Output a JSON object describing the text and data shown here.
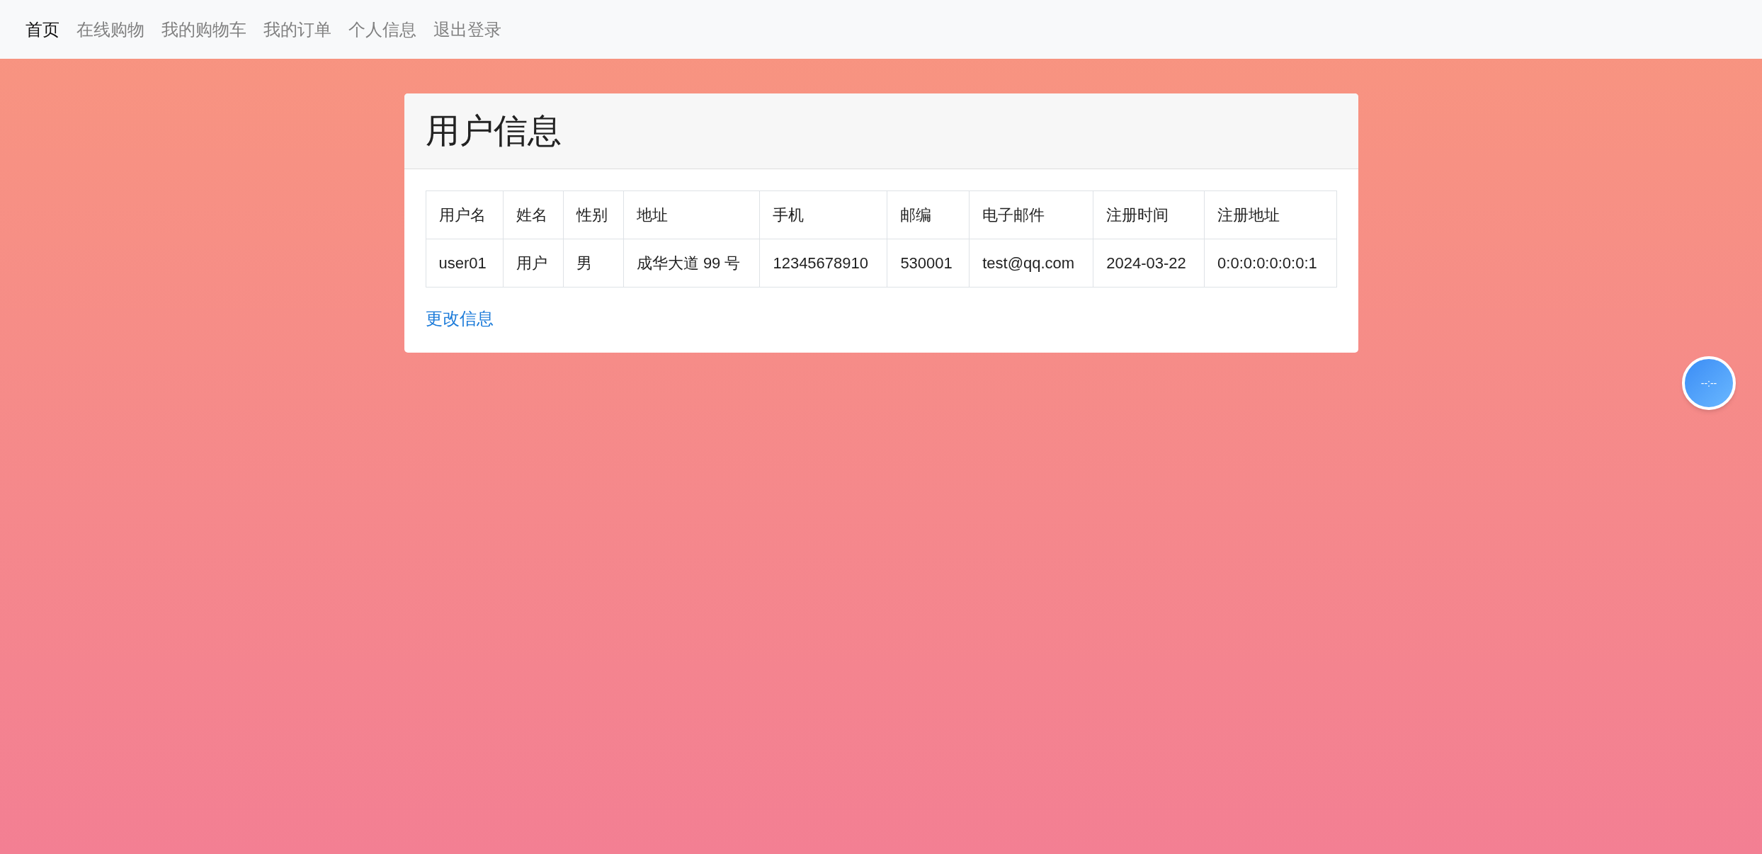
{
  "navbar": {
    "items": [
      {
        "label": "首页",
        "selected": true
      },
      {
        "label": "在线购物",
        "selected": false
      },
      {
        "label": "我的购物车",
        "selected": false
      },
      {
        "label": "我的订单",
        "selected": false
      },
      {
        "label": "个人信息",
        "selected": false
      },
      {
        "label": "退出登录",
        "selected": false
      }
    ]
  },
  "card": {
    "title": "用户信息",
    "table": {
      "columns": [
        "用户名",
        "姓名",
        "性别",
        "地址",
        "手机",
        "邮编",
        "电子邮件",
        "注册时间",
        "注册地址"
      ],
      "rows": [
        [
          "user01",
          "用户",
          "男",
          "成华大道 99 号",
          "12345678910",
          "530001",
          "test@qq.com",
          "2024-03-22",
          "0:0:0:0:0:0:0:1"
        ]
      ]
    },
    "link": "更改信息"
  },
  "clock_widget": {
    "time": "--:--"
  }
}
